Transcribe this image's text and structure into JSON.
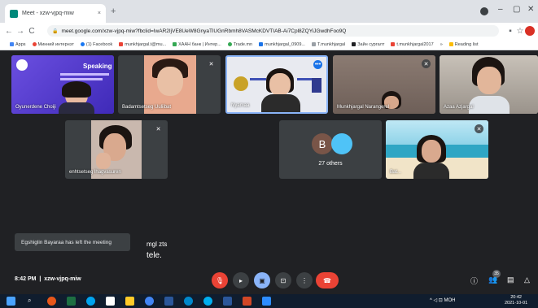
{
  "browser": {
    "tab_title": "Meet - xzw-vjpq-miw",
    "tab_close": "×",
    "new_tab": "+",
    "url": "meet.google.com/xzw-vjpq-miw?fbclid=IwAR2IjVE8UeW8GnyaTlUGnRbmh8VASMcKDVTIAB-Ai7Cpl8ZQYiJGwdhFoo9Q",
    "bookmarks": [
      {
        "label": "Apps",
        "color": "#4285f4"
      },
      {
        "label": "Минний интернэт",
        "color": "#ea4335"
      },
      {
        "label": "(1) Facebook",
        "color": "#1877f2"
      },
      {
        "label": "munkhjargal.t@mu...",
        "color": "#ea4335"
      },
      {
        "label": "ХААН банк | Интер...",
        "color": "#34a853"
      },
      {
        "label": "Trade.mn",
        "color": "#34a853"
      },
      {
        "label": "munkhjargal_0909...",
        "color": "#1a73e8"
      },
      {
        "label": "T.munkhjargal",
        "color": "#9aa0a6"
      },
      {
        "label": "Зайн сургалт",
        "color": "#202124"
      },
      {
        "label": "t.munkhjargal2017",
        "color": "#ea4335"
      },
      {
        "label": "»",
        "color": "#ffffff"
      },
      {
        "label": "Reading list",
        "color": "#fbbc04"
      }
    ]
  },
  "tiles": [
    {
      "name": "Oyunerdenе Choiji",
      "muted": false,
      "type": "slide",
      "slide_title": "Speaking"
    },
    {
      "name": "Badamtsetseg Uuliibat",
      "muted": true,
      "type": "person"
    },
    {
      "name": "Nyamaa",
      "muted": false,
      "type": "presenter"
    },
    {
      "name": "Munkhjargal Narangerel",
      "muted": true,
      "type": "person"
    },
    {
      "name": "Azaa Azjargal",
      "muted": false,
      "type": "person"
    },
    {
      "name": "enhtsetseg lhagvasuren",
      "muted": true,
      "type": "person"
    },
    {
      "name": "27 others",
      "muted": false,
      "type": "others",
      "avatar_letter": "B"
    },
    {
      "name": "Bat...",
      "muted": true,
      "type": "beach"
    }
  ],
  "toast": "Egshiglin Bayaraa has left the meeting",
  "chat_lines": [
    "mgl zts",
    "tele."
  ],
  "bottom": {
    "time": "8:42 PM",
    "separator": "|",
    "meeting_code": "xzw-vjpq-miw",
    "people_count": "35"
  },
  "taskbar": {
    "tray": "^ ◁ ⊡ МОН",
    "time": "20:42",
    "date": "2021-10-01"
  },
  "colors": {
    "meet_bg": "#202124",
    "tile_bg": "#3c4043",
    "red": "#ea4335",
    "blue": "#1a73e8"
  }
}
